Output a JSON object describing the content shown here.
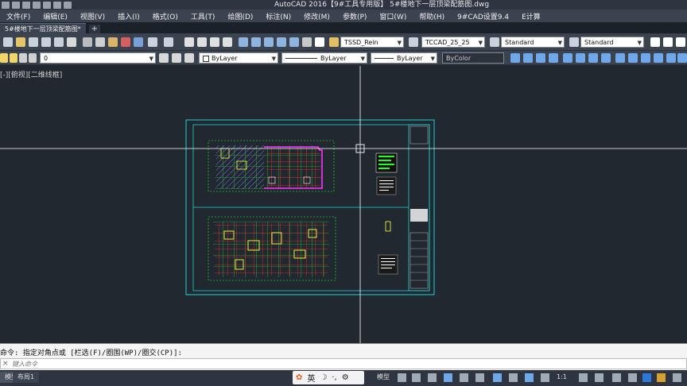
{
  "app": {
    "title": "AutoCAD 2016【9#工具专用版】   5#楼地下一层顶梁配筋图.dwg"
  },
  "menu": [
    "文件(F)",
    "编辑(E)",
    "视图(V)",
    "插入(I)",
    "格式(O)",
    "工具(T)",
    "绘图(D)",
    "标注(N)",
    "修改(M)",
    "参数(P)",
    "窗口(W)",
    "帮助(H)",
    "9#CAD设置9.4",
    "E计算"
  ],
  "tabs": {
    "active": "5#楼地下一层顶梁配筋图*",
    "add": "+"
  },
  "toolbar1": {
    "text_style": "TSSD_Rein",
    "dim_style": "TCCAD_25_25",
    "table_style": "Standard",
    "multileader_style": "Standard"
  },
  "toolbar2": {
    "layer": "0",
    "color": "ByLayer",
    "linetype": "ByLayer",
    "lineweight": "ByLayer",
    "plot_style": "ByColor"
  },
  "viewport": {
    "label": "[-][俯视][二维线框]"
  },
  "command": {
    "history": "命令: 指定对角点或 [栏选(F)/圈围(WP)/圈交(CP)]:",
    "placeholder": "键入命令"
  },
  "status": {
    "model_tab": "模型",
    "layout_tab": "布局1",
    "model_btn": "模型",
    "ime_lang": "英",
    "scale": "1:1"
  },
  "colors": {
    "accent_cyan": "#1fd0d0",
    "beam_red": "#ff3030",
    "rebar_green": "#20ff20",
    "highlight_magenta": "#ff30ff",
    "background": "#212830"
  }
}
